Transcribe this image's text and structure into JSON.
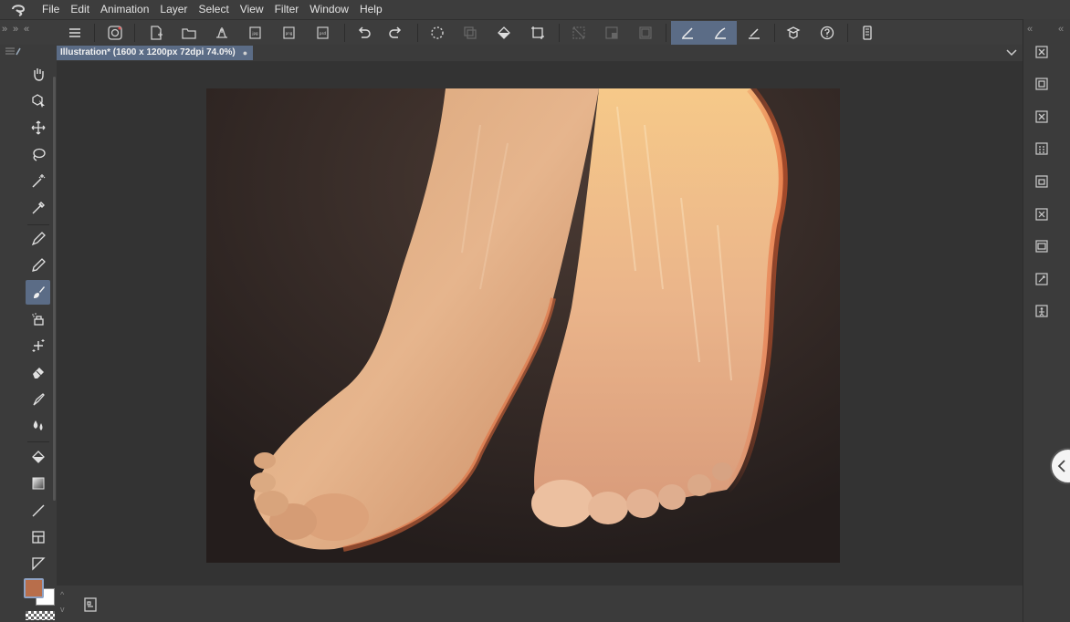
{
  "menubar": {
    "logo_icon": "clip-studio-logo-icon",
    "items": [
      "File",
      "Edit",
      "Animation",
      "Layer",
      "Select",
      "View",
      "Filter",
      "Window",
      "Help"
    ]
  },
  "command_bar": {
    "left_collapse": "»",
    "left_expand": "«",
    "right_collapse": "«",
    "right_expand": "»",
    "buttons": [
      {
        "name": "menu-icon"
      },
      {
        "name": "clip-studio-icon"
      },
      {
        "name": "new-file-icon"
      },
      {
        "name": "open-folder-icon"
      },
      {
        "name": "save-icon"
      },
      {
        "name": "export-jpg-icon"
      },
      {
        "name": "export-png-icon"
      },
      {
        "name": "export-psd-icon"
      },
      {
        "name": "undo-icon"
      },
      {
        "name": "redo-icon"
      },
      {
        "name": "clear-selection-icon"
      },
      {
        "name": "crop-layer-icon"
      },
      {
        "name": "fill-icon"
      },
      {
        "name": "transform-icon"
      },
      {
        "name": "hide-selection-icon"
      },
      {
        "name": "convert-selection-icon"
      },
      {
        "name": "border-icon"
      },
      {
        "name": "snap-ruler-icon",
        "active": true
      },
      {
        "name": "snap-special-ruler-icon",
        "active": true
      },
      {
        "name": "snap-grid-icon"
      },
      {
        "name": "clip-studio-assets-icon"
      },
      {
        "name": "help-icon"
      },
      {
        "name": "smartphone-icon"
      }
    ]
  },
  "document": {
    "tab_title": "Illustration* (1600 x 1200px 72dpi 74.0%)",
    "close_icon": "close-icon",
    "chevron_icon": "chevron-down-icon"
  },
  "tools": [
    {
      "name": "hand-tool-icon"
    },
    {
      "name": "object-tool-icon"
    },
    {
      "name": "move-tool-icon"
    },
    {
      "name": "lasso-tool-icon"
    },
    {
      "name": "magic-wand-tool-icon"
    },
    {
      "name": "eyedropper-tool-icon"
    },
    {
      "name": "pen-tool-icon"
    },
    {
      "name": "pencil-tool-icon"
    },
    {
      "name": "brush-tool-icon",
      "active": true
    },
    {
      "name": "airbrush-tool-icon"
    },
    {
      "name": "decoration-tool-icon"
    },
    {
      "name": "eraser-tool-icon"
    },
    {
      "name": "blend-tool-icon"
    },
    {
      "name": "liquify-tool-icon"
    },
    {
      "name": "fill-tool-icon"
    },
    {
      "name": "gradient-tool-icon"
    },
    {
      "name": "line-tool-icon"
    },
    {
      "name": "frame-tool-icon"
    },
    {
      "name": "ruler-tool-icon"
    }
  ],
  "colors": {
    "main_color": "#b86e4b",
    "sub_color": "#ffffff",
    "accent": "#5b6c86"
  },
  "right_panel": {
    "buttons": [
      {
        "name": "close-palette-icon"
      },
      {
        "name": "layer-property-icon"
      },
      {
        "name": "close-palette-2-icon"
      },
      {
        "name": "tone-palette-icon"
      },
      {
        "name": "sub-view-icon"
      },
      {
        "name": "navigator-icon"
      },
      {
        "name": "layer-palette-icon"
      },
      {
        "name": "history-icon"
      },
      {
        "name": "material-palette-icon"
      }
    ],
    "handle_icon": "chevron-left-icon"
  },
  "bottom_bar": {
    "navigator_icon": "navigator-toggle-icon",
    "scroll_up": "^",
    "scroll_down": "v"
  },
  "canvas": {
    "artwork": "painting-of-feet"
  }
}
